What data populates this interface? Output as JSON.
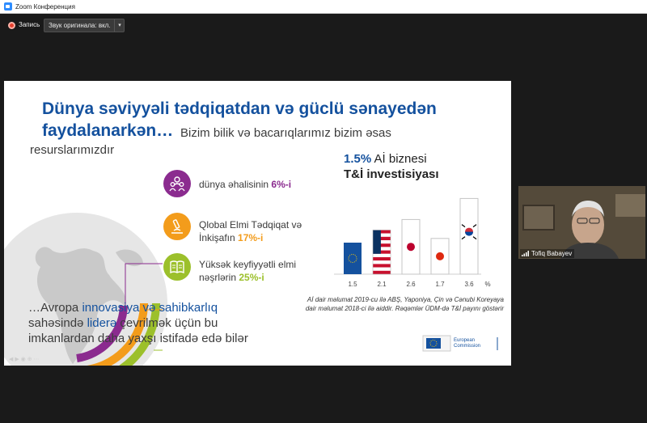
{
  "window": {
    "title": "Zoom Конференция"
  },
  "recording": {
    "label": "Запись",
    "audio_button": "Звук оригинала: вкл.",
    "arrow": "▾"
  },
  "slide": {
    "title_line1": "Dünya səviyyəli tədqiqatdan və güclü sənayedən",
    "title_line2": "faydalanarkən…",
    "title_line2_rest": "Bizim bilik və bacarıqlarımız bizim əsas",
    "title_line3": "resurslarımızdır",
    "stats": [
      {
        "text": "dünya əhalisinin ",
        "pct": "6%-i",
        "icon": "people-icon",
        "color": "#8b2b8f"
      },
      {
        "text": "Qlobal Elmi Tədqiqat və",
        "text2": "İnkişafın ",
        "pct": "17%-i",
        "icon": "microscope-icon",
        "color": "#f39c1b"
      },
      {
        "text": "Yüksək keyfiyyətli elmi",
        "text2": "nəşrlərin ",
        "pct": "25%-i",
        "icon": "book-icon",
        "color": "#9cc02b"
      }
    ],
    "bottom": {
      "part1": "…Avropa ",
      "blue1": "innovasiya və sahibkarlıq",
      "part2": "sahəsində ",
      "blue2": "liderə",
      "part3": " çevrilmək üçün bu imkanlardan daha yaxşı istifadə edə bilər"
    },
    "right_title_pct": "1.5%",
    "right_title_rest": " Aİ biznesi",
    "right_title_line2": "T&İ investisiyası",
    "note": "Aİ  dair məlumat 2019-cu ilə ABŞ, Yaponiya, Çin və   Cənubi Koreyaya dair  məlumat 2018-ci ilə aiddir. Rəqəmlər ÜDM-də T&İ payını  göstərir",
    "ec_label_1": "European",
    "ec_label_2": "Commission",
    "ctrl": "◀ ▶ ◉ ⊕ ⋯"
  },
  "chart_data": {
    "type": "bar",
    "categories": [
      "EU",
      "USA",
      "Japan",
      "China",
      "South Korea"
    ],
    "tick_labels": [
      "1.5",
      "2.1",
      "2.6",
      "1.7",
      "3.6",
      "%"
    ],
    "values": [
      1.5,
      2.1,
      2.6,
      1.7,
      3.6
    ],
    "ylim": [
      0,
      4
    ]
  },
  "video": {
    "name": "Tofiq Babayev"
  }
}
